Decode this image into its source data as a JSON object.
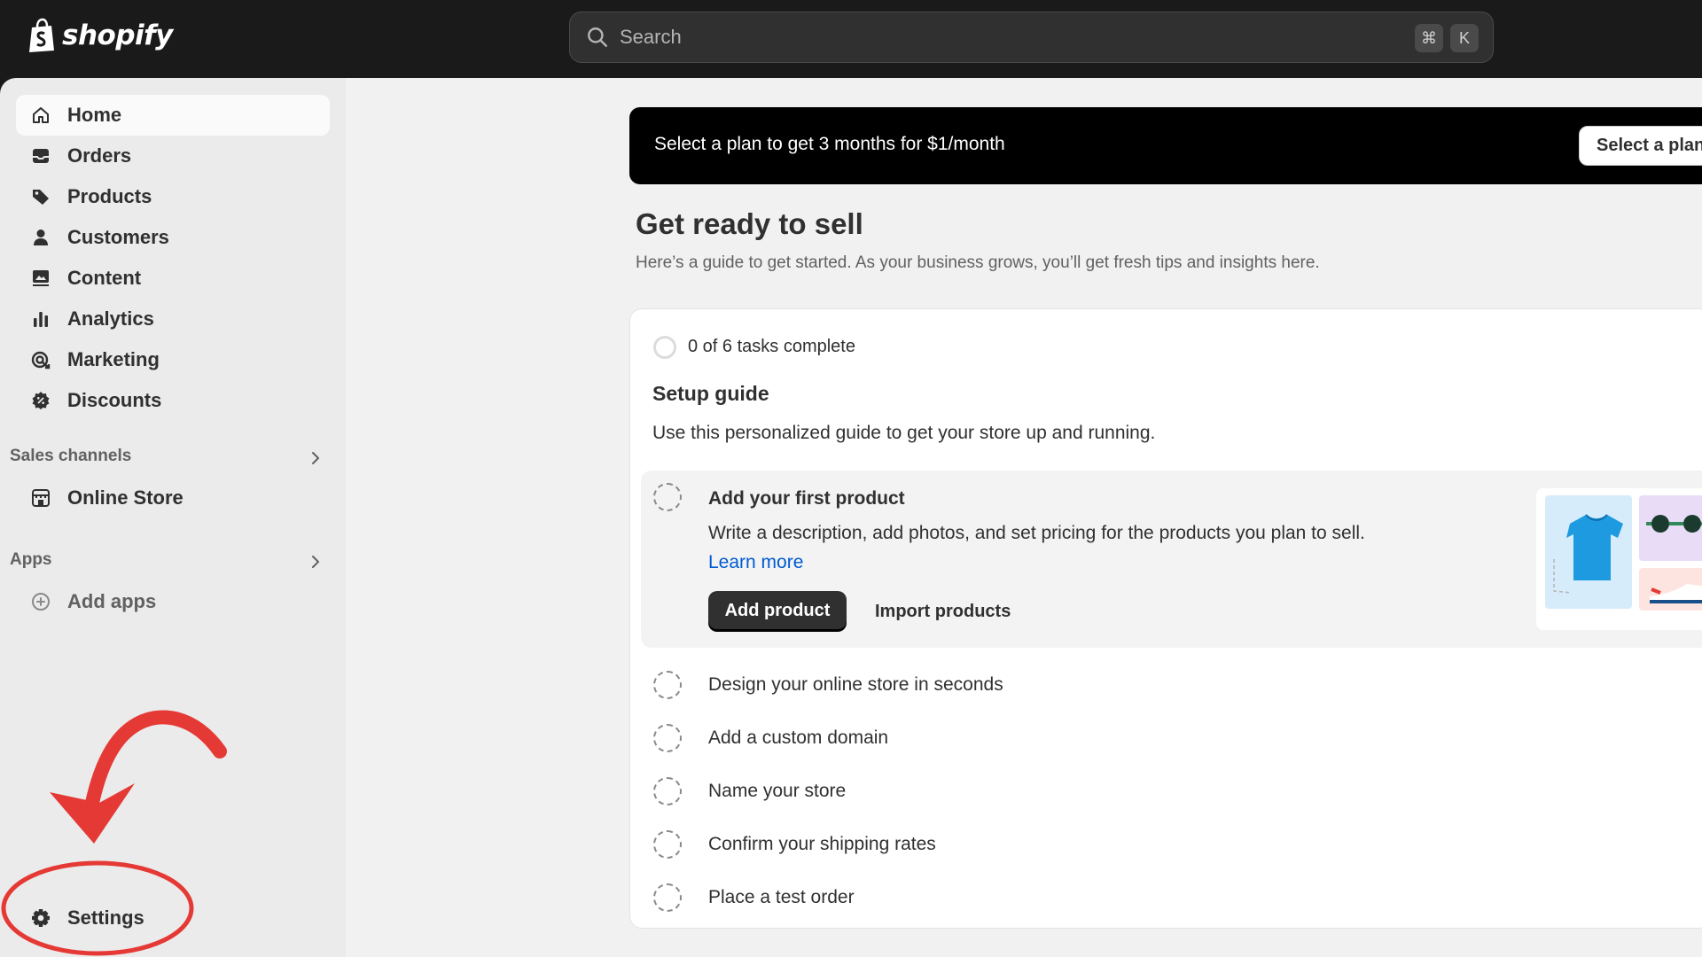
{
  "app": {
    "brand": "shopify"
  },
  "search": {
    "placeholder": "Search",
    "shortcut_cmd": "⌘",
    "shortcut_key": "K"
  },
  "sidebar": {
    "items": [
      {
        "label": "Home",
        "icon": "home-icon",
        "active": true
      },
      {
        "label": "Orders",
        "icon": "inbox-icon"
      },
      {
        "label": "Products",
        "icon": "tag-icon"
      },
      {
        "label": "Customers",
        "icon": "person-icon"
      },
      {
        "label": "Content",
        "icon": "image-icon"
      },
      {
        "label": "Analytics",
        "icon": "bar-chart-icon"
      },
      {
        "label": "Marketing",
        "icon": "target-icon"
      },
      {
        "label": "Discounts",
        "icon": "discount-icon"
      }
    ],
    "sales_channels": {
      "title": "Sales channels",
      "items": [
        {
          "label": "Online Store",
          "icon": "store-icon"
        }
      ]
    },
    "apps": {
      "title": "Apps",
      "items": [
        {
          "label": "Add apps",
          "icon": "plus-circle-icon"
        }
      ]
    },
    "settings": {
      "label": "Settings",
      "icon": "gear-icon"
    }
  },
  "banner": {
    "text": "Select a plan to get 3 months for $1/month",
    "button": "Select a plan"
  },
  "page": {
    "title": "Get ready to sell",
    "subtitle": "Here’s a guide to get started. As your business grows, you’ll get fresh tips and insights here."
  },
  "setup": {
    "progress": "0 of 6 tasks complete",
    "progress_value": 0,
    "title": "Setup guide",
    "subtitle": "Use this personalized guide to get your store up and running.",
    "expanded_task": {
      "title": "Add your first product",
      "description": "Write a description, add photos, and set pricing for the products you plan to sell.",
      "learn_more": "Learn more",
      "primary_button": "Add product",
      "secondary_button": "Import products"
    },
    "tasks": [
      "Design your online store in seconds",
      "Add a custom domain",
      "Name your store",
      "Confirm your shipping rates",
      "Place a test order"
    ]
  },
  "colors": {
    "topbar": "#1a1a1a",
    "sidebar": "#ebebeb",
    "main_bg": "#f1f1f1",
    "link": "#005bd3",
    "annotation": "#e53935"
  }
}
